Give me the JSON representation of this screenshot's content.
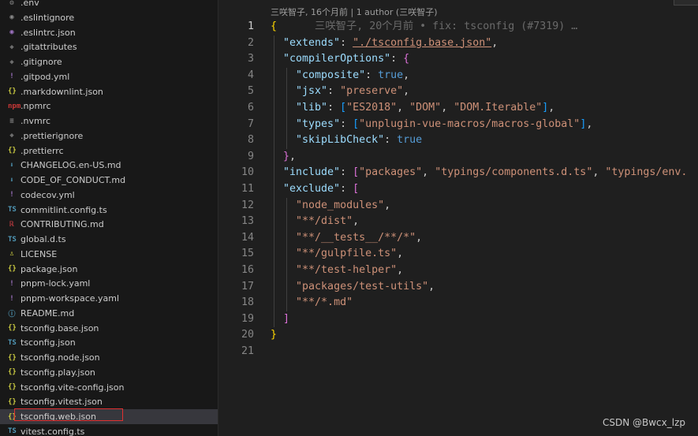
{
  "sidebar": {
    "files": [
      {
        "label": ".env",
        "icon": "gear-icon",
        "glyph": "⚙",
        "color": "#8b8b8b"
      },
      {
        "label": ".eslintignore",
        "icon": "eslint-icon",
        "glyph": "◉",
        "color": "#8b8b8b"
      },
      {
        "label": ".eslintrc.json",
        "icon": "eslint-icon",
        "glyph": "◉",
        "color": "#a074c4"
      },
      {
        "label": ".gitattributes",
        "icon": "git-icon",
        "glyph": "◆",
        "color": "#6d6d6d"
      },
      {
        "label": ".gitignore",
        "icon": "git-icon",
        "glyph": "◆",
        "color": "#6d6d6d"
      },
      {
        "label": ".gitpod.yml",
        "icon": "yaml-icon",
        "glyph": "!",
        "color": "#a074c4"
      },
      {
        "label": ".markdownlint.json",
        "icon": "json-icon",
        "glyph": "{}",
        "color": "#cbcb41"
      },
      {
        "label": ".npmrc",
        "icon": "npm-icon",
        "glyph": "npm",
        "color": "#cb3837"
      },
      {
        "label": ".nvmrc",
        "icon": "lines-icon",
        "glyph": "≡",
        "color": "#8b8b8b"
      },
      {
        "label": ".prettierignore",
        "icon": "prettier-icon",
        "glyph": "◆",
        "color": "#6d6d6d"
      },
      {
        "label": ".prettierrc",
        "icon": "json-icon",
        "glyph": "{}",
        "color": "#cbcb41"
      },
      {
        "label": "CHANGELOG.en-US.md",
        "icon": "markdown-icon",
        "glyph": "⬇",
        "color": "#519aba"
      },
      {
        "label": "CODE_OF_CONDUCT.md",
        "icon": "markdown-icon",
        "glyph": "⬇",
        "color": "#519aba"
      },
      {
        "label": "codecov.yml",
        "icon": "yaml-icon",
        "glyph": "!",
        "color": "#a074c4"
      },
      {
        "label": "commitlint.config.ts",
        "icon": "typescript-icon",
        "glyph": "TS",
        "color": "#519aba"
      },
      {
        "label": "CONTRIBUTING.md",
        "icon": "contributing-icon",
        "glyph": "ℝ",
        "color": "#cc3e44"
      },
      {
        "label": "global.d.ts",
        "icon": "typescript-icon",
        "glyph": "TS",
        "color": "#519aba"
      },
      {
        "label": "LICENSE",
        "icon": "license-icon",
        "glyph": "♙",
        "color": "#cbcb41"
      },
      {
        "label": "package.json",
        "icon": "json-icon",
        "glyph": "{}",
        "color": "#cbcb41"
      },
      {
        "label": "pnpm-lock.yaml",
        "icon": "yaml-icon",
        "glyph": "!",
        "color": "#a074c4"
      },
      {
        "label": "pnpm-workspace.yaml",
        "icon": "yaml-icon",
        "glyph": "!",
        "color": "#a074c4"
      },
      {
        "label": "README.md",
        "icon": "info-icon",
        "glyph": "ⓘ",
        "color": "#519aba"
      },
      {
        "label": "tsconfig.base.json",
        "icon": "json-icon",
        "glyph": "{}",
        "color": "#cbcb41"
      },
      {
        "label": "tsconfig.json",
        "icon": "tsconfig-icon",
        "glyph": "TS",
        "color": "#519aba"
      },
      {
        "label": "tsconfig.node.json",
        "icon": "json-icon",
        "glyph": "{}",
        "color": "#cbcb41"
      },
      {
        "label": "tsconfig.play.json",
        "icon": "json-icon",
        "glyph": "{}",
        "color": "#cbcb41"
      },
      {
        "label": "tsconfig.vite-config.json",
        "icon": "json-icon",
        "glyph": "{}",
        "color": "#cbcb41"
      },
      {
        "label": "tsconfig.vitest.json",
        "icon": "json-icon",
        "glyph": "{}",
        "color": "#cbcb41"
      },
      {
        "label": "tsconfig.web.json",
        "icon": "json-icon",
        "glyph": "{}",
        "color": "#cbcb41",
        "selected": true
      },
      {
        "label": "vitest.config.ts",
        "icon": "typescript-icon",
        "glyph": "TS",
        "color": "#519aba"
      }
    ]
  },
  "editor": {
    "blame_header": "三咲智子, 16个月前 | 1 author (三咲智子)",
    "inline_blame": "三咲智子, 20个月前 • fix: tsconfig (#7319) …",
    "line_numbers": [
      "1",
      "2",
      "3",
      "4",
      "5",
      "6",
      "7",
      "8",
      "9",
      "10",
      "11",
      "12",
      "13",
      "14",
      "15",
      "16",
      "17",
      "18",
      "19",
      "20",
      "21"
    ],
    "lines": [
      [
        {
          "t": "{",
          "c": "b1"
        }
      ],
      [
        {
          "t": "  "
        },
        {
          "t": "\"extends\"",
          "c": "key"
        },
        {
          "t": ": "
        },
        {
          "t": "\"./tsconfig.base.json\"",
          "c": "link"
        },
        {
          "t": ","
        }
      ],
      [
        {
          "t": "  "
        },
        {
          "t": "\"compilerOptions\"",
          "c": "key"
        },
        {
          "t": ": "
        },
        {
          "t": "{",
          "c": "b2"
        }
      ],
      [
        {
          "t": "    "
        },
        {
          "t": "\"composite\"",
          "c": "key"
        },
        {
          "t": ": "
        },
        {
          "t": "true",
          "c": "bool"
        },
        {
          "t": ","
        }
      ],
      [
        {
          "t": "    "
        },
        {
          "t": "\"jsx\"",
          "c": "key"
        },
        {
          "t": ": "
        },
        {
          "t": "\"preserve\"",
          "c": "str"
        },
        {
          "t": ","
        }
      ],
      [
        {
          "t": "    "
        },
        {
          "t": "\"lib\"",
          "c": "key"
        },
        {
          "t": ": "
        },
        {
          "t": "[",
          "c": "b3"
        },
        {
          "t": "\"ES2018\"",
          "c": "str"
        },
        {
          "t": ", "
        },
        {
          "t": "\"DOM\"",
          "c": "str"
        },
        {
          "t": ", "
        },
        {
          "t": "\"DOM.Iterable\"",
          "c": "str"
        },
        {
          "t": "]",
          "c": "b3"
        },
        {
          "t": ","
        }
      ],
      [
        {
          "t": "    "
        },
        {
          "t": "\"types\"",
          "c": "key"
        },
        {
          "t": ": "
        },
        {
          "t": "[",
          "c": "b3"
        },
        {
          "t": "\"unplugin-vue-macros/macros-global\"",
          "c": "str"
        },
        {
          "t": "]",
          "c": "b3"
        },
        {
          "t": ","
        }
      ],
      [
        {
          "t": "    "
        },
        {
          "t": "\"skipLibCheck\"",
          "c": "key"
        },
        {
          "t": ": "
        },
        {
          "t": "true",
          "c": "bool"
        }
      ],
      [
        {
          "t": "  "
        },
        {
          "t": "}",
          "c": "b2"
        },
        {
          "t": ","
        }
      ],
      [
        {
          "t": "  "
        },
        {
          "t": "\"include\"",
          "c": "key"
        },
        {
          "t": ": "
        },
        {
          "t": "[",
          "c": "b2"
        },
        {
          "t": "\"packages\"",
          "c": "str"
        },
        {
          "t": ", "
        },
        {
          "t": "\"typings/components.d.ts\"",
          "c": "str"
        },
        {
          "t": ", "
        },
        {
          "t": "\"typings/env.",
          "c": "str"
        }
      ],
      [
        {
          "t": "  "
        },
        {
          "t": "\"exclude\"",
          "c": "key"
        },
        {
          "t": ": "
        },
        {
          "t": "[",
          "c": "b2"
        }
      ],
      [
        {
          "t": "    "
        },
        {
          "t": "\"node_modules\"",
          "c": "str"
        },
        {
          "t": ","
        }
      ],
      [
        {
          "t": "    "
        },
        {
          "t": "\"**/dist\"",
          "c": "str"
        },
        {
          "t": ","
        }
      ],
      [
        {
          "t": "    "
        },
        {
          "t": "\"**/__tests__/**/*\"",
          "c": "str"
        },
        {
          "t": ","
        }
      ],
      [
        {
          "t": "    "
        },
        {
          "t": "\"**/gulpfile.ts\"",
          "c": "str"
        },
        {
          "t": ","
        }
      ],
      [
        {
          "t": "    "
        },
        {
          "t": "\"**/test-helper\"",
          "c": "str"
        },
        {
          "t": ","
        }
      ],
      [
        {
          "t": "    "
        },
        {
          "t": "\"packages/test-utils\"",
          "c": "str"
        },
        {
          "t": ","
        }
      ],
      [
        {
          "t": "    "
        },
        {
          "t": "\"**/*.md\"",
          "c": "str"
        }
      ],
      [
        {
          "t": "  "
        },
        {
          "t": "]",
          "c": "b2"
        }
      ],
      [
        {
          "t": "}",
          "c": "b1"
        }
      ],
      []
    ]
  },
  "watermark": "CSDN @Bwcx_lzp"
}
